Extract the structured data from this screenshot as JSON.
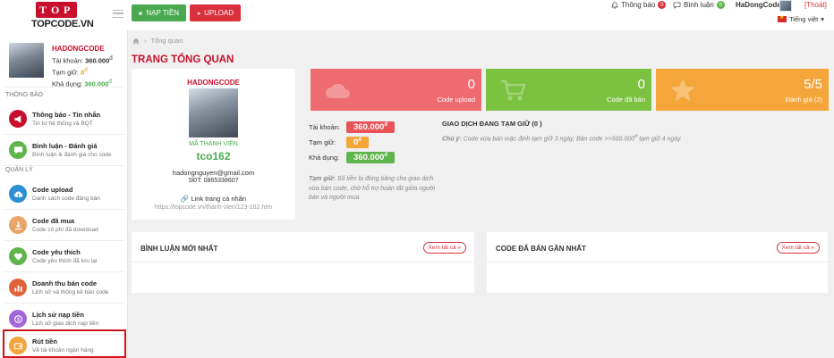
{
  "topbar": {
    "logo_text": "TOPCODE.VN",
    "nap_tien_label": "NẠP TIỀN",
    "upload_label": "UPLOAD",
    "notifications_label": "Thông báo",
    "notifications_count": "0",
    "comments_label": "Bình luận",
    "comments_count": "0",
    "username": "HaDongCode",
    "logout_label": "[Thoát]",
    "language_label": "Tiếng việt"
  },
  "sidebar": {
    "username": "HADONGCODE",
    "balance_label": "Tài khoản:",
    "balance_value": "360.000",
    "held_label": "Tạm giữ:",
    "held_value": "0",
    "available_label": "Khả dụng:",
    "available_value": "360.000",
    "currency_symbol": "đ",
    "section_notify": "THÔNG BÁO",
    "section_manage": "QUẢN LÝ",
    "items": [
      {
        "title": "Thông báo - Tin nhắn",
        "subtitle": "Tin từ hệ thống và BQT",
        "color": "#c8102e",
        "icon": "megaphone-icon"
      },
      {
        "title": "Bình luận - Đánh giá",
        "subtitle": "Bình luận & đánh giá cho code",
        "color": "#5fb44b",
        "icon": "chat-icon"
      },
      {
        "title": "Code upload",
        "subtitle": "Danh sách code đăng bán",
        "color": "#2b8fd6",
        "icon": "cloud-upload-icon"
      },
      {
        "title": "Code đã mua",
        "subtitle": "Code có phí đã download",
        "color": "#e8a56a",
        "icon": "download-icon"
      },
      {
        "title": "Code yêu thích",
        "subtitle": "Code yêu thích đã lưu lại",
        "color": "#5fb44b",
        "icon": "heart-icon"
      },
      {
        "title": "Doanh thu bán code",
        "subtitle": "Lịch sử và thống kê bán code",
        "color": "#e0623b",
        "icon": "chart-icon"
      },
      {
        "title": "Lịch sử nạp tiền",
        "subtitle": "Lịch sử giao dịch nạp tiền",
        "color": "#a366d6",
        "icon": "money-icon"
      },
      {
        "title": "Rút tiền",
        "subtitle": "Về tài khoản ngân hàng",
        "color": "#f3a43c",
        "icon": "wallet-icon"
      }
    ]
  },
  "main": {
    "breadcrumb": "Tổng quan",
    "title": "TRANG TỔNG QUAN",
    "profile": {
      "name": "HADONGCODE",
      "member_label": "MÃ THÀNH VIÊN",
      "member_code": "tco162",
      "email": "hadongnguyen@gmail.com",
      "phone": "SĐT: 0865338607",
      "link_label": "Link trang cá nhân",
      "link_url": "https://topcode.vn/thanh-vien/123-162.htm"
    },
    "stats": [
      {
        "value": "0",
        "label": "Code upload",
        "color": "#ee6b6f",
        "icon": "cloud-upload-icon"
      },
      {
        "value": "0",
        "label": "Code đã bán",
        "color": "#7cc241",
        "icon": "cart-icon"
      },
      {
        "value": "5/5",
        "label": "Đánh giá (2)",
        "color": "#f5a63a",
        "icon": "star-icon"
      }
    ],
    "balance": {
      "total_label": "Tài khoản:",
      "total_value": "360.000",
      "held_label": "Tạm giữ:",
      "held_value": "0",
      "available_label": "Khả dụng:",
      "available_value": "360.000",
      "currency_symbol": "đ",
      "note_prefix": "Tạm giữ:",
      "note_text": "Số tiền bị đóng băng cho giao dịch vừa bán code, chờ hỗ trợ hoàn tất giữa người bán và người mua"
    },
    "pending": {
      "title": "GIAO DỊCH ĐANG TẠM GIỮ (0 )",
      "note_prefix": "Chú ý:",
      "note_text": "Code vừa bán mặc định tạm giữ 3 ngày, Bán code >>500.000",
      "note_suffix": "tạm giữ 4 ngày"
    },
    "panels": {
      "comments_title": "BÌNH LUẬN MỚI NHẤT",
      "sold_title": "CODE ĐÃ BÁN GẦN NHẤT",
      "see_all": "Xem tất cả »"
    }
  }
}
